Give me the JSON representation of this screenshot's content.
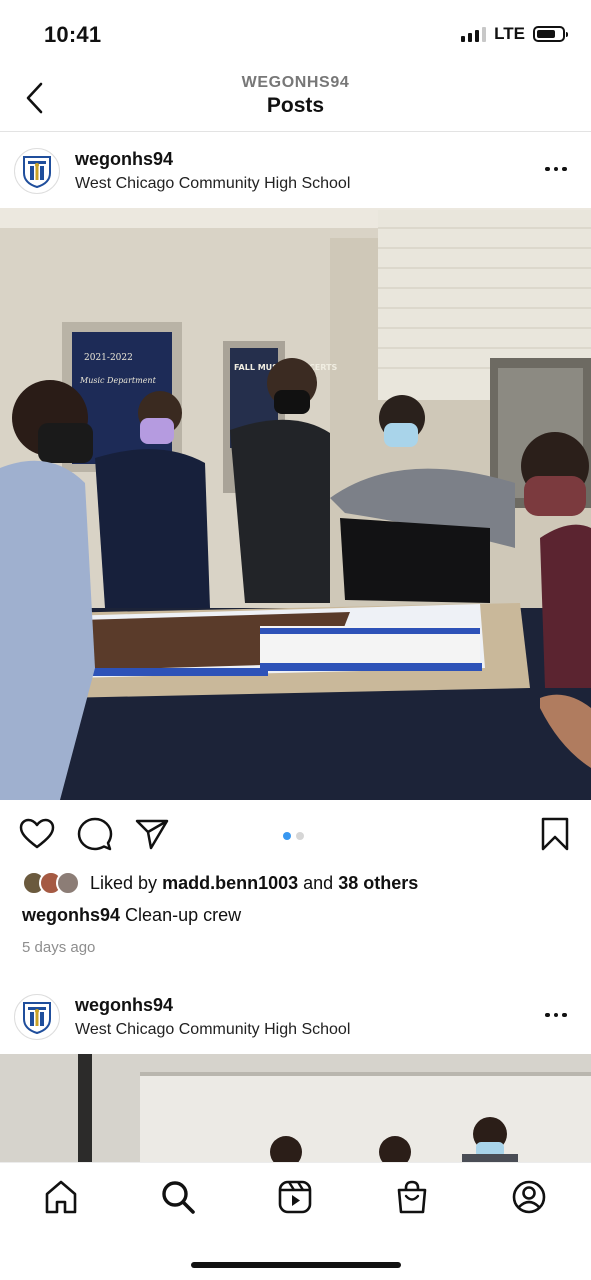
{
  "status": {
    "time": "10:41",
    "network": "LTE",
    "signal_bars": 3,
    "battery_level": 0.75
  },
  "header": {
    "account": "WEGONHS94",
    "title": "Posts"
  },
  "posts": [
    {
      "username": "wegonhs94",
      "location": "West Chicago Community High School",
      "image": {
        "poster_1": "2021-2022",
        "poster_2": "Music Department",
        "poster_3": "FALL MUSIC CONCERTS"
      },
      "carousel": {
        "count": 2,
        "active": 0
      },
      "liked_by_prefix": "Liked by",
      "liked_by_user": "madd.benn1003",
      "liked_by_and": "and",
      "liked_by_others": "38 others",
      "caption_user": "wegonhs94",
      "caption_text": "Clean-up crew",
      "time_ago": "5 days ago"
    },
    {
      "username": "wegonhs94",
      "location": "West Chicago Community High School"
    }
  ],
  "icons": {
    "back": "chevron-left-icon",
    "more": "more-horizontal-icon",
    "like": "heart-icon",
    "comment": "comment-icon",
    "share": "paper-plane-icon",
    "save": "bookmark-icon",
    "home": "home-icon",
    "search": "search-icon",
    "reels": "reels-icon",
    "shop": "shopping-bag-icon",
    "profile": "profile-icon"
  },
  "colors": {
    "accent": "#3897f0",
    "text": "#111111",
    "muted": "#8e8e8e",
    "school_blue": "#1f4e9c"
  }
}
